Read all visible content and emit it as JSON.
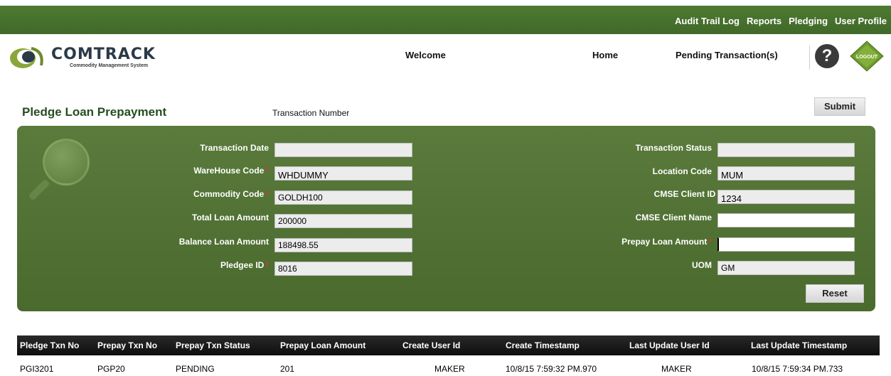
{
  "topnav": {
    "items": [
      "Audit Trail Log",
      "Reports",
      "Pledging",
      "User Profile"
    ]
  },
  "header": {
    "logo_brand": "COMTRACK",
    "logo_tagline": "Commodity Management System",
    "welcome": "Welcome",
    "home": "Home",
    "pending": "Pending Transaction(s)",
    "help_glyph": "?",
    "logout_label": "LOGOUT"
  },
  "page": {
    "title": "Pledge Loan Prepayment",
    "transaction_number_label": "Transaction Number",
    "submit_label": "Submit",
    "reset_label": "Reset"
  },
  "form": {
    "transaction_date": {
      "label": "Transaction Date",
      "value": ""
    },
    "warehouse_code": {
      "label": "WareHouse Code",
      "value": "WHDUMMY",
      "required": "*"
    },
    "commodity_code": {
      "label": "Commodity Code",
      "value": "GOLDH100",
      "required": "*"
    },
    "total_loan_amount": {
      "label": "Total Loan Amount",
      "value": "200000"
    },
    "balance_loan_amount": {
      "label": "Balance Loan Amount",
      "value": "188498.55"
    },
    "pledgee_id": {
      "label": "Pledgee ID",
      "value": "8016",
      "required": "*"
    },
    "transaction_status": {
      "label": "Transaction Status",
      "value": ""
    },
    "location_code": {
      "label": "Location Code",
      "value": "MUM"
    },
    "cmse_client_id": {
      "label": "CMSE Client ID",
      "value": "1234",
      "required": "*"
    },
    "cmse_client_name": {
      "label": "CMSE Client Name",
      "value": ""
    },
    "prepay_loan_amount": {
      "label": "Prepay Loan Amount",
      "value": "",
      "required": "*"
    },
    "uom": {
      "label": "UOM",
      "value": "GM"
    }
  },
  "table": {
    "headers": [
      "Pledge Txn No",
      "Prepay Txn No",
      "Prepay Txn Status",
      "Prepay Loan Amount",
      "Create User Id",
      "Create Timestamp",
      "Last Update User Id",
      "Last Update Timestamp"
    ],
    "rows": [
      [
        "PGI3201",
        "PGP20",
        "PENDING",
        "201",
        "MAKER",
        "10/8/15 7:59:32 PM.970",
        "MAKER",
        "10/8/15 7:59:34 PM.733"
      ]
    ]
  },
  "colors": {
    "topbar": "#4d7a32",
    "panel": "#5a7b3c",
    "title": "#264d22",
    "required": "#d9362a"
  }
}
